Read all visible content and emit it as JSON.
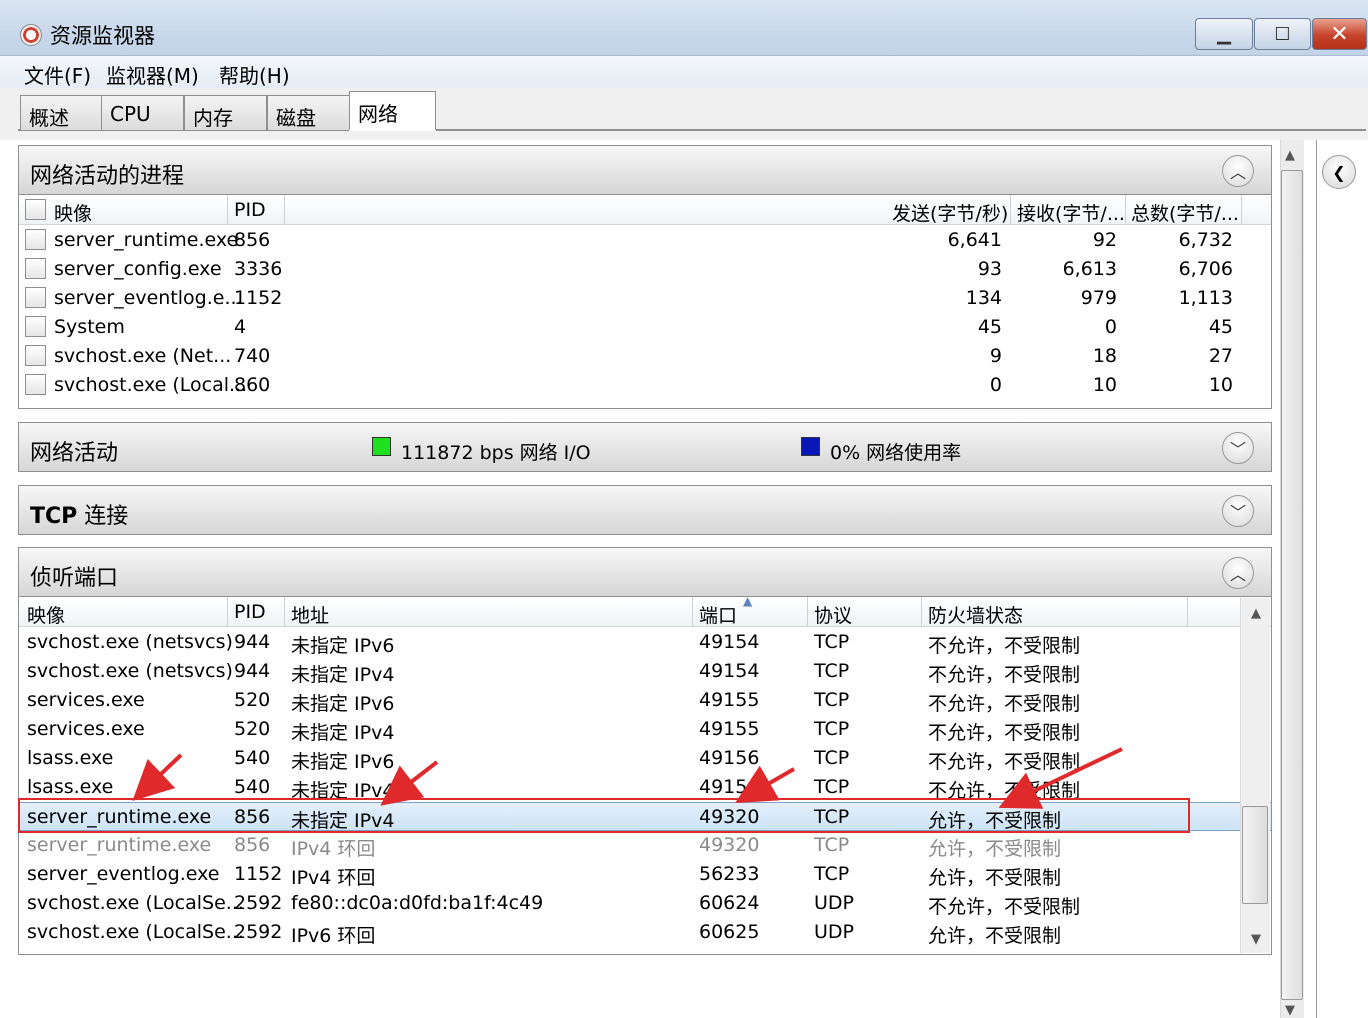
{
  "window": {
    "title": "资源监视器",
    "min_label": "▁",
    "max_label": "☐",
    "close_label": "✕"
  },
  "menu": [
    "文件(F)",
    "监视器(M)",
    "帮助(H)"
  ],
  "tabs": [
    "概述",
    "CPU",
    "内存",
    "磁盘",
    "网络"
  ],
  "active_tab": "网络",
  "processes": {
    "title": "网络活动的进程",
    "columns": [
      "映像",
      "PID",
      "发送(字节/秒)",
      "接收(字节/...",
      "总数(字节/..."
    ],
    "rows": [
      {
        "image": "server_runtime.exe",
        "pid": "856",
        "send": "6,641",
        "recv": "92",
        "total": "6,732"
      },
      {
        "image": "server_config.exe",
        "pid": "3336",
        "send": "93",
        "recv": "6,613",
        "total": "6,706"
      },
      {
        "image": "server_eventlog.e...",
        "pid": "1152",
        "send": "134",
        "recv": "979",
        "total": "1,113"
      },
      {
        "image": "System",
        "pid": "4",
        "send": "45",
        "recv": "0",
        "total": "45"
      },
      {
        "image": "svchost.exe (Net...",
        "pid": "740",
        "send": "9",
        "recv": "18",
        "total": "27"
      },
      {
        "image": "svchost.exe (Local...",
        "pid": "860",
        "send": "0",
        "recv": "10",
        "total": "10"
      }
    ]
  },
  "network_activity": {
    "title": "网络活动",
    "io_label": "111872 bps 网络 I/O",
    "usage_label": "0% 网络使用率",
    "io_color": "#1ee01e",
    "usage_color": "#0a17b8"
  },
  "tcp": {
    "title": "TCP 连接",
    "title_bold": "TCP",
    "title_rest": " 连接"
  },
  "listening": {
    "title": "侦听端口",
    "columns": [
      "映像",
      "PID",
      "地址",
      "端口",
      "协议",
      "防火墙状态"
    ],
    "rows": [
      {
        "image": "svchost.exe (netsvcs)",
        "pid": "944",
        "addr": "未指定 IPv6",
        "port": "49154",
        "proto": "TCP",
        "fw": "不允许，不受限制"
      },
      {
        "image": "svchost.exe (netsvcs)",
        "pid": "944",
        "addr": "未指定 IPv4",
        "port": "49154",
        "proto": "TCP",
        "fw": "不允许，不受限制"
      },
      {
        "image": "services.exe",
        "pid": "520",
        "addr": "未指定 IPv6",
        "port": "49155",
        "proto": "TCP",
        "fw": "不允许，不受限制"
      },
      {
        "image": "services.exe",
        "pid": "520",
        "addr": "未指定 IPv4",
        "port": "49155",
        "proto": "TCP",
        "fw": "不允许，不受限制"
      },
      {
        "image": "lsass.exe",
        "pid": "540",
        "addr": "未指定 IPv6",
        "port": "49156",
        "proto": "TCP",
        "fw": "不允许，不受限制"
      },
      {
        "image": "lsass.exe",
        "pid": "540",
        "addr": "未指定 IPv4",
        "port": "49156",
        "proto": "TCP",
        "fw": "不允许，不受限制"
      },
      {
        "image": "server_runtime.exe",
        "pid": "856",
        "addr": "未指定 IPv4",
        "port": "49320",
        "proto": "TCP",
        "fw": "允许，不受限制"
      },
      {
        "image": "server_runtime.exe",
        "pid": "856",
        "addr": "IPv4 环回",
        "port": "49320",
        "proto": "TCP",
        "fw": "允许，不受限制"
      },
      {
        "image": "server_eventlog.exe",
        "pid": "1152",
        "addr": "IPv4 环回",
        "port": "56233",
        "proto": "TCP",
        "fw": "允许，不受限制"
      },
      {
        "image": "svchost.exe (LocalSe...",
        "pid": "2592",
        "addr": "fe80::dc0a:d0fd:ba1f:4c49",
        "port": "60624",
        "proto": "UDP",
        "fw": "不允许，不受限制"
      },
      {
        "image": "svchost.exe (LocalSe...",
        "pid": "2592",
        "addr": "IPv6 环回",
        "port": "60625",
        "proto": "UDP",
        "fw": "允许，不受限制"
      }
    ],
    "selected_row": 6
  },
  "colors": {
    "selection": "#cde3f7",
    "annotation": "#e0292a",
    "green_legend": "#1ee01e",
    "blue_legend": "#0a17b8"
  }
}
